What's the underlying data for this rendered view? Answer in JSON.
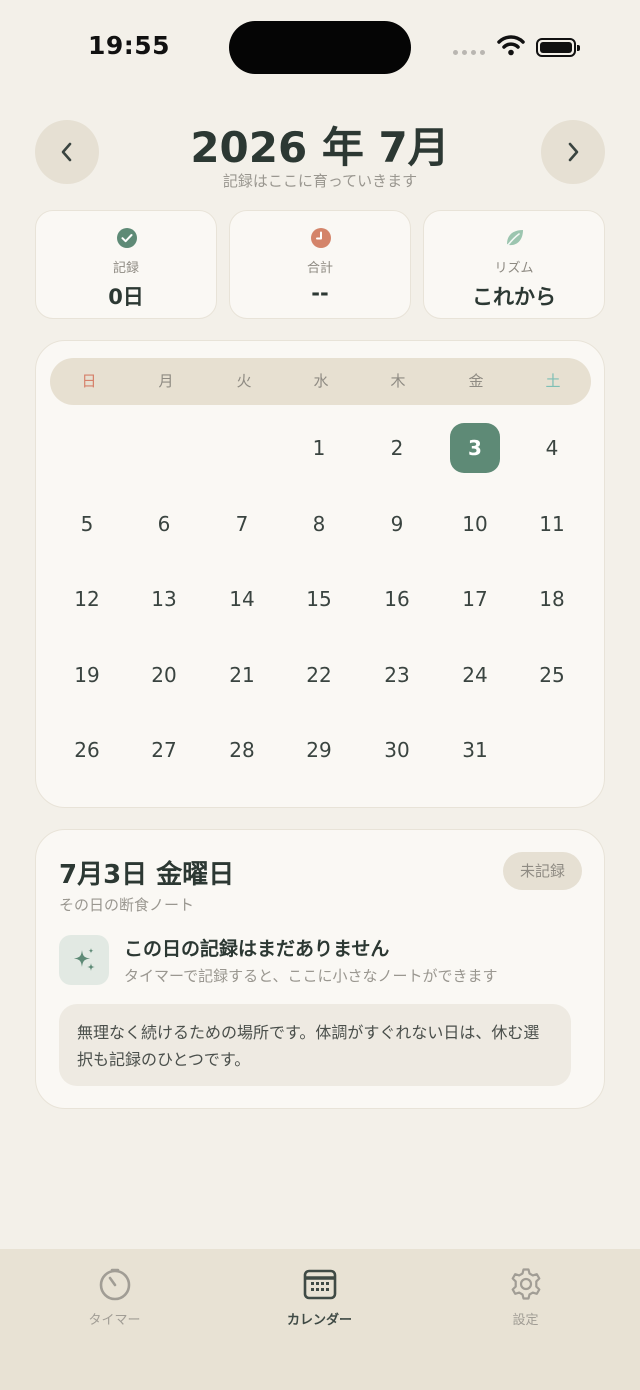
{
  "status": {
    "time": "19:55"
  },
  "header": {
    "title": "2026 年 7月",
    "subtitle": "記録はここに育っていきます",
    "prev_icon": "chevron-left-icon",
    "next_icon": "chevron-right-icon"
  },
  "stats": [
    {
      "icon": "check-circle-icon",
      "label": "記録",
      "value": "0日",
      "color": "#5e8a76"
    },
    {
      "icon": "clock-icon",
      "label": "合計",
      "value": "--",
      "color": "#d4846a"
    },
    {
      "icon": "leaf-icon",
      "label": "リズム",
      "value": "これから",
      "color": "#8fb8a2"
    }
  ],
  "calendar": {
    "weekdays": [
      "日",
      "月",
      "火",
      "水",
      "木",
      "金",
      "土"
    ],
    "weekday_colors": {
      "sunday": "#d6806a",
      "saturday": "#7ebfb5"
    },
    "days": [
      "1",
      "2",
      "3",
      "4",
      "5",
      "6",
      "7",
      "8",
      "9",
      "10",
      "11",
      "12",
      "13",
      "14",
      "15",
      "16",
      "17",
      "18",
      "19",
      "20",
      "21",
      "22",
      "23",
      "24",
      "25",
      "26",
      "27",
      "28",
      "29",
      "30",
      "31"
    ],
    "first_weekday_index": 3,
    "selected_day": "3",
    "accent": "#5e8a76"
  },
  "detail": {
    "date_title": "7月3日 金曜日",
    "subtitle": "その日の断食ノート",
    "badge": "未記録",
    "empty_icon": "sparkles-icon",
    "empty_title": "この日の記録はまだありません",
    "empty_sub": "タイマーで記録すると、ここに小さなノートができます",
    "note": "無理なく続けるための場所です。体調がすぐれない日は、休む選択も記録のひとつです。"
  },
  "tabs": [
    {
      "label": "タイマー",
      "icon": "timer-icon",
      "active": false
    },
    {
      "label": "カレンダー",
      "icon": "calendar-icon",
      "active": true
    },
    {
      "label": "設定",
      "icon": "gear-icon",
      "active": false
    }
  ]
}
